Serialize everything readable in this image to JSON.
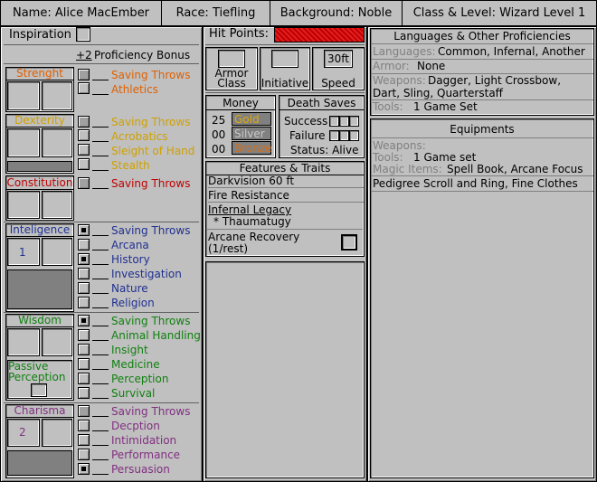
{
  "header": {
    "name": "Name: Alice MacEmber",
    "race": "Race: Tiefling",
    "background": "Background: Noble",
    "class_level": "Class & Level: Wizard Level 1"
  },
  "inspiration": {
    "label": "Inspiration"
  },
  "proficiency": {
    "value": "+2",
    "label": "Proficiency Bonus"
  },
  "abilities": {
    "strength": {
      "name": "Strenght",
      "color": "#e06000",
      "skills": [
        "Saving Throws",
        "Athletics"
      ]
    },
    "dexterity": {
      "name": "Dexterity",
      "color": "#d0a000",
      "skills": [
        "Saving Throws",
        "Acrobatics",
        "Sleight of Hand",
        "Stealth"
      ]
    },
    "constitution": {
      "name": "Constitution",
      "color": "#c00000",
      "skills": [
        "Saving Throws"
      ]
    },
    "intelligence": {
      "name": "Inteligence",
      "color": "#203090",
      "mod": "1",
      "skills": [
        "Saving Throws",
        "Arcana",
        "History",
        "Investigation",
        "Nature",
        "Religion"
      ]
    },
    "wisdom": {
      "name": "Wisdom",
      "color": "#108010",
      "skills": [
        "Saving Throws",
        "Animal Handling",
        "Insight",
        "Medicine",
        "Perception",
        "Survival"
      ],
      "passive": "Passive Perception"
    },
    "charisma": {
      "name": "Charisma",
      "color": "#803080",
      "mod": "2",
      "skills": [
        "Saving Throws",
        "Decption",
        "Intimidation",
        "Performance",
        "Persuasion"
      ]
    }
  },
  "hp": {
    "label": "Hit Points:",
    "color": "#c00000"
  },
  "combat": {
    "armor": "Armor Class",
    "initiative": "Initiative",
    "speed": "Speed",
    "speed_value": "30ft"
  },
  "money": {
    "title": "Money",
    "gold_amt": "25",
    "gold": "Gold",
    "silver_amt": "00",
    "silver": "Silver",
    "bronze_amt": "00",
    "bronze": "Bronze"
  },
  "death": {
    "title": "Death Saves",
    "success": "Success",
    "failure": "Failure",
    "status": "Status: Alive"
  },
  "features": {
    "title": "Features & Traits",
    "items": [
      "Darkvision 60 ft",
      "Fire Resistance",
      "Infernal Legacy",
      "* Thaumatugy",
      "Arcane Recovery",
      "(1/rest)"
    ]
  },
  "languages": {
    "title": "Languages & Other Proficiencies",
    "lang_label": "Languages:",
    "lang": "Common, Infernal, Another",
    "armor_label": "Armor:",
    "armor": "None",
    "weapons_label": "Weapons:",
    "weapons1": "Dagger, Light Crossbow,",
    "weapons2": "Dart, Sling, Quarterstaff",
    "tools_label": "Tools:",
    "tools": "1 Game Set"
  },
  "equipment": {
    "title": "Equipments",
    "weapons_label": "Weapons:",
    "tools_label": "Tools:",
    "tools": "1 Game set",
    "magic_label": "Magic Items:",
    "magic": "Spell Book, Arcane Focus",
    "extra": "Pedigree Scroll and Ring, Fine Clothes"
  }
}
